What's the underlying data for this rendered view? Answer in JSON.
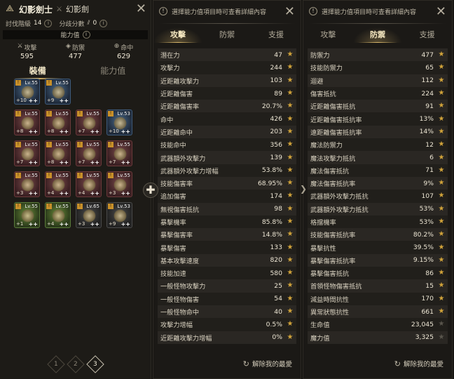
{
  "character": {
    "class_name": "幻影劍士",
    "weapon_name": "幻影劍",
    "subdue_label": "討伐階級",
    "subdue_value": "14",
    "branch_label": "分歧分數",
    "branch_value": "0",
    "ability_label": "能力值"
  },
  "summary": [
    {
      "label": "攻擊",
      "value": "595",
      "icon": "sword-icon"
    },
    {
      "label": "防禦",
      "value": "477",
      "icon": "shield-icon"
    },
    {
      "label": "命中",
      "value": "629",
      "icon": "crosshair-icon"
    }
  ],
  "left_tabs": [
    "裝備",
    "能力值"
  ],
  "equipment": [
    {
      "level": "Lv.55",
      "enh": "+10",
      "color": "blue"
    },
    {
      "level": "Lv.55",
      "enh": "+9",
      "color": "blue"
    },
    {
      "level": "Lv.55",
      "enh": "+8",
      "color": "red"
    },
    {
      "level": "Lv.55",
      "enh": "+8",
      "color": "red"
    },
    {
      "level": "Lv.55",
      "enh": "+7",
      "color": "red"
    },
    {
      "level": "Lv.53",
      "enh": "+10",
      "color": "blue"
    },
    {
      "level": "Lv.55",
      "enh": "+7",
      "color": "red"
    },
    {
      "level": "Lv.55",
      "enh": "+8",
      "color": "red"
    },
    {
      "level": "Lv.55",
      "enh": "+7",
      "color": "red"
    },
    {
      "level": "Lv.55",
      "enh": "+7",
      "color": "red"
    },
    {
      "level": "Lv.55",
      "enh": "+3",
      "color": "red"
    },
    {
      "level": "Lv.55",
      "enh": "+4",
      "color": "red"
    },
    {
      "level": "Lv.55",
      "enh": "+4",
      "color": "red"
    },
    {
      "level": "Lv.55",
      "enh": "+3",
      "color": "red"
    },
    {
      "level": "Lv.55",
      "enh": "+1",
      "color": "green"
    },
    {
      "level": "Lv.55",
      "enh": "+4",
      "color": "green"
    },
    {
      "level": "Lv.65",
      "enh": "+3",
      "color": "grey"
    },
    {
      "level": "Lv.53",
      "enh": "+9",
      "color": "grey"
    }
  ],
  "pages": [
    "1",
    "2",
    "3"
  ],
  "notice": "選擇能力值項目時可查看詳細內容",
  "stat_tabs": [
    "攻擊",
    "防禦",
    "支援"
  ],
  "reset_label": "解除我的最愛",
  "attack_stats": [
    {
      "name": "潛在力",
      "value": "47",
      "fav": true
    },
    {
      "name": "攻擊力",
      "value": "244",
      "fav": true
    },
    {
      "name": "近距離攻擊力",
      "value": "103",
      "fav": true
    },
    {
      "name": "近距離傷害",
      "value": "89",
      "fav": true
    },
    {
      "name": "近距離傷害率",
      "value": "20.7%",
      "fav": true
    },
    {
      "name": "命中",
      "value": "426",
      "fav": true
    },
    {
      "name": "近距離命中",
      "value": "203",
      "fav": true
    },
    {
      "name": "技能命中",
      "value": "356",
      "fav": true
    },
    {
      "name": "武器額外攻擊力",
      "value": "139",
      "fav": true
    },
    {
      "name": "武器額外攻擊力增幅",
      "value": "53.8%",
      "fav": true
    },
    {
      "name": "技能傷害率",
      "value": "68.95%",
      "fav": true
    },
    {
      "name": "追加傷害",
      "value": "174",
      "fav": true
    },
    {
      "name": "無視傷害抵抗",
      "value": "98",
      "fav": true
    },
    {
      "name": "暴擊機率",
      "value": "85.8%",
      "fav": true
    },
    {
      "name": "暴擊傷害率",
      "value": "14.8%",
      "fav": true
    },
    {
      "name": "暴擊傷害",
      "value": "133",
      "fav": true
    },
    {
      "name": "基本攻擊速度",
      "value": "820",
      "fav": true
    },
    {
      "name": "技能加速",
      "value": "580",
      "fav": true
    },
    {
      "name": "一般怪物攻擊力",
      "value": "25",
      "fav": true
    },
    {
      "name": "一般怪物傷害",
      "value": "54",
      "fav": true
    },
    {
      "name": "一般怪物命中",
      "value": "40",
      "fav": true
    },
    {
      "name": "攻擊力增幅",
      "value": "0.5%",
      "fav": true
    },
    {
      "name": "近距離攻擊力增幅",
      "value": "0%",
      "fav": true
    }
  ],
  "defense_stats": [
    {
      "name": "防禦力",
      "value": "477",
      "fav": true
    },
    {
      "name": "技能防禦力",
      "value": "65",
      "fav": true
    },
    {
      "name": "迴避",
      "value": "112",
      "fav": true
    },
    {
      "name": "傷害抵抗",
      "value": "224",
      "fav": true
    },
    {
      "name": "近距離傷害抵抗",
      "value": "91",
      "fav": true
    },
    {
      "name": "近距離傷害抵抗率",
      "value": "13%",
      "fav": true
    },
    {
      "name": "遠距離傷害抵抗率",
      "value": "14%",
      "fav": true
    },
    {
      "name": "魔法防禦力",
      "value": "12",
      "fav": true
    },
    {
      "name": "魔法攻擊力抵抗",
      "value": "6",
      "fav": true
    },
    {
      "name": "魔法傷害抵抗",
      "value": "71",
      "fav": true
    },
    {
      "name": "魔法傷害抵抗率",
      "value": "9%",
      "fav": true
    },
    {
      "name": "武器額外攻擊力抵抗",
      "value": "107",
      "fav": true
    },
    {
      "name": "武器額外攻擊力抵抗",
      "value": "53%",
      "fav": true
    },
    {
      "name": "格擋機率",
      "value": "53%",
      "fav": true
    },
    {
      "name": "技能傷害抵抗率",
      "value": "80.2%",
      "fav": true
    },
    {
      "name": "暴擊抗性",
      "value": "39.5%",
      "fav": true
    },
    {
      "name": "暴擊傷害抵抗率",
      "value": "9.15%",
      "fav": true
    },
    {
      "name": "暴擊傷害抵抗",
      "value": "86",
      "fav": true
    },
    {
      "name": "首領怪物傷害抵抗",
      "value": "15",
      "fav": true
    },
    {
      "name": "減益時間抗性",
      "value": "170",
      "fav": true
    },
    {
      "name": "異常狀態抗性",
      "value": "661",
      "fav": true
    },
    {
      "name": "生命值",
      "value": "23,045",
      "fav": false
    },
    {
      "name": "魔力值",
      "value": "3,325",
      "fav": false
    }
  ]
}
